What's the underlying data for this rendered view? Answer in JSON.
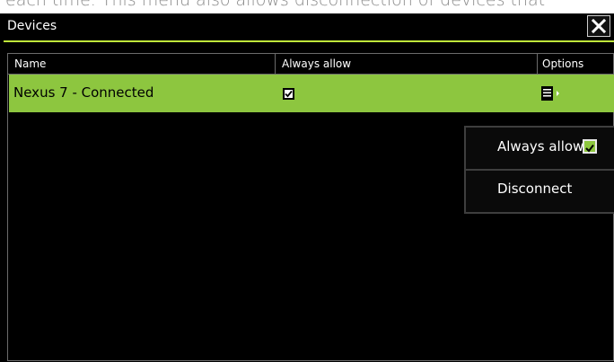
{
  "background_caption": "each time. This menu also allows disconnection of devices that",
  "dialog": {
    "title": "Devices"
  },
  "table": {
    "columns": [
      "Name",
      "Always allow",
      "Options"
    ],
    "rows": [
      {
        "name": "Nexus 7 - Connected",
        "always_allow": true
      }
    ]
  },
  "popup_menu": {
    "items": [
      {
        "label": "Always allow",
        "checked": true
      },
      {
        "label": "Disconnect"
      }
    ]
  },
  "colors": {
    "accent": "#8dc63f",
    "title_underline": "#bfe63a",
    "background": "#000000",
    "text": "#ffffff"
  },
  "icons": {
    "close": "close-icon",
    "check": "checkmark-icon",
    "options": "options-menu-icon"
  }
}
